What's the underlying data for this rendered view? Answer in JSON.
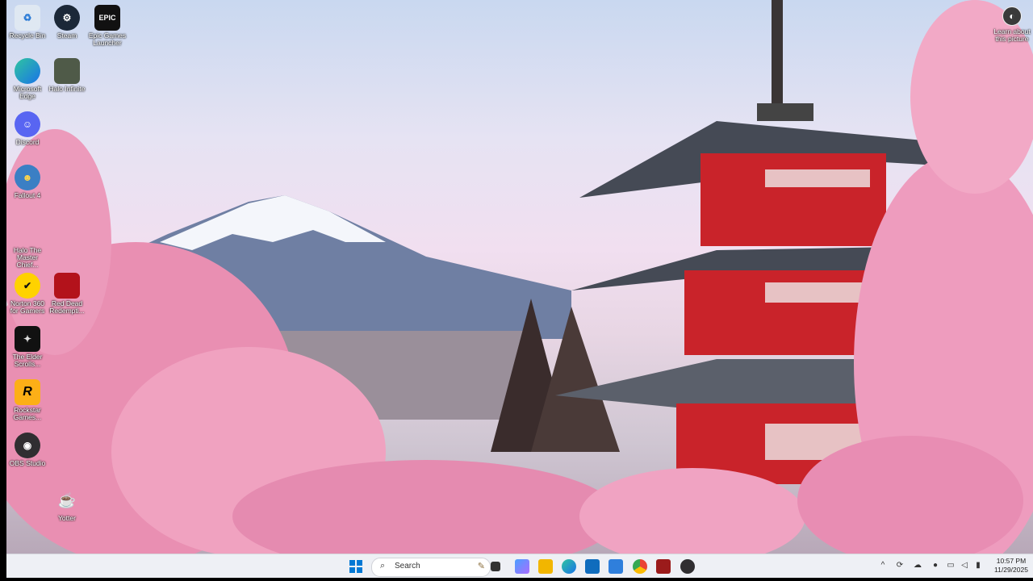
{
  "desktop": {
    "icons": [
      {
        "label": "Recycle Bin",
        "icon": "recycle-bin-icon"
      },
      {
        "label": "Steam",
        "icon": "steam-icon"
      },
      {
        "label": "Epic Games Launcher",
        "icon": "epic-games-icon",
        "glyph": "EPIC"
      },
      {
        "label": "Microsoft Edge",
        "icon": "edge-icon"
      },
      {
        "label": "Halo Infinite",
        "icon": "halo-infinite-icon"
      },
      {
        "label": "Discord",
        "icon": "discord-icon"
      },
      {
        "label": "Fallout 4",
        "icon": "fallout-4-icon"
      },
      {
        "label": "Halo The Master Chief...",
        "icon": "halo-mcc-icon"
      },
      {
        "label": "Norton 360 for Gamers",
        "icon": "norton-icon"
      },
      {
        "label": "Red Dead Redempti...",
        "icon": "red-dead-icon"
      },
      {
        "label": "The Elder Scrolls...",
        "icon": "elder-scrolls-icon"
      },
      {
        "label": "Rockstar Games...",
        "icon": "rockstar-icon",
        "glyph": "R"
      },
      {
        "label": "OBS Studio",
        "icon": "obs-icon"
      },
      {
        "label": "Yotter",
        "icon": "yotter-icon"
      }
    ],
    "learn_picture": {
      "label": "Learn about this picture",
      "icon": "camera-icon"
    }
  },
  "taskbar": {
    "search_label": "Search",
    "apps": [
      "windows-start-icon",
      "task-view-icon",
      "store-icon",
      "file-explorer-icon",
      "edge-icon",
      "microsoft-store-icon",
      "mail-icon",
      "chrome-icon",
      "game-launcher-icon",
      "obs-icon"
    ],
    "time": "10:57 PM",
    "date": "11/29/2025"
  },
  "colors": {
    "accent": "#0067c0",
    "taskbar": "#eef0f5"
  }
}
